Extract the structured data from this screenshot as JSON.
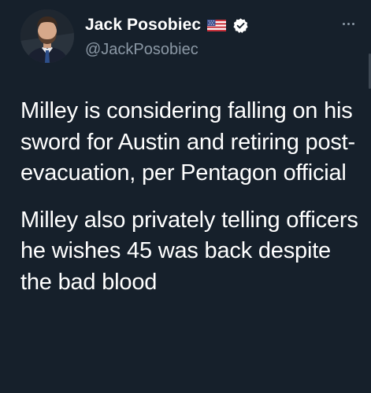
{
  "author": {
    "display_name": "Jack Posobiec",
    "handle": "@JackPosobiec",
    "flag_icon": "us-flag-icon",
    "verified_icon": "verified-badge-icon",
    "verified_color": "#ffffff"
  },
  "menu": {
    "icon": "more-horizontal-icon"
  },
  "tweet": {
    "paragraphs": [
      "Milley is considering falling on his sword for Austin and retiring post-evacuation, per Pentagon official",
      "Milley also privately telling officers he wishes 45 was back despite the bad blood"
    ]
  },
  "colors": {
    "background": "#16202b",
    "text_primary": "#ffffff",
    "text_secondary": "#8b98a5"
  }
}
